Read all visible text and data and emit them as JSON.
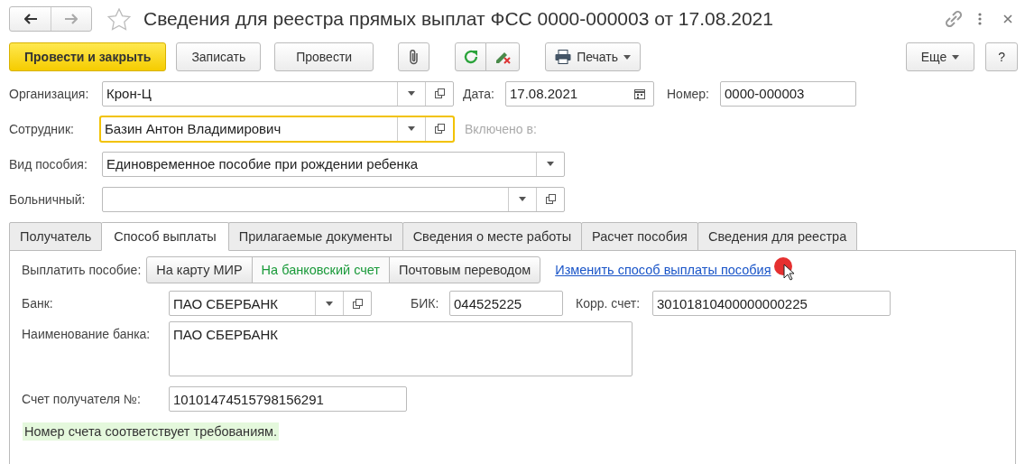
{
  "window": {
    "title": "Сведения для реестра прямых выплат ФСС 0000-000003 от 17.08.2021"
  },
  "toolbar": {
    "buttons": [
      {
        "label": "Провести и закрыть",
        "kind": "primary"
      },
      {
        "label": "Записать",
        "kind": "normal"
      },
      {
        "label": "Провести",
        "kind": "normal"
      }
    ],
    "print": {
      "label": "Печать"
    },
    "more": {
      "label": "Еще"
    },
    "help": {
      "label": "?"
    }
  },
  "header": {
    "organization": {
      "label": "Организация:",
      "value": "Крон-Ц",
      "focused": false
    },
    "date": {
      "label": "Дата:",
      "value": "17.08.2021"
    },
    "number": {
      "label": "Номер:",
      "value": "0000-000003"
    },
    "employee": {
      "label": "Сотрудник:",
      "value": "Базин Антон Владимирович",
      "focused": true
    },
    "included_in": {
      "label": "Включено в:",
      "disabled": true
    },
    "benefit_type": {
      "label": "Вид пособия:",
      "value": "Единовременное пособие при рождении ребенка",
      "focused": false
    },
    "sick_leave": {
      "label": "Больничный:",
      "focused": false
    }
  },
  "tabs": [
    {
      "label": "Получатель",
      "selected": false
    },
    {
      "label": "Способ выплаты",
      "selected": true
    },
    {
      "label": "Прилагаемые документы",
      "selected": false
    },
    {
      "label": "Сведения о месте работы",
      "selected": false
    },
    {
      "label": "Расчет пособия",
      "selected": false
    },
    {
      "label": "Сведения для реестра",
      "selected": false
    }
  ],
  "payment": {
    "label": "Выплатить пособие:",
    "options": [
      {
        "label": "На карту МИР",
        "selected": false
      },
      {
        "label": "На банковский счет",
        "selected": true
      },
      {
        "label": "Почтовым переводом",
        "selected": false
      }
    ],
    "change_link": "Изменить способ выплаты пособия"
  },
  "bank": {
    "label": "Банк:",
    "value": "ПАО СБЕРБАНК"
  },
  "bik": {
    "label": "БИК:",
    "value": "044525225"
  },
  "corr_account": {
    "label": "Корр. счет:",
    "value": "30101810400000000225"
  },
  "bank_name": {
    "label": "Наименование банка:",
    "value": "ПАО СБЕРБАНК"
  },
  "account": {
    "label": "Счет получателя №:",
    "value": "10101474515798156291"
  },
  "account_status": {
    "text": "Номер счета соответствует требованиям.",
    "valid": true
  }
}
